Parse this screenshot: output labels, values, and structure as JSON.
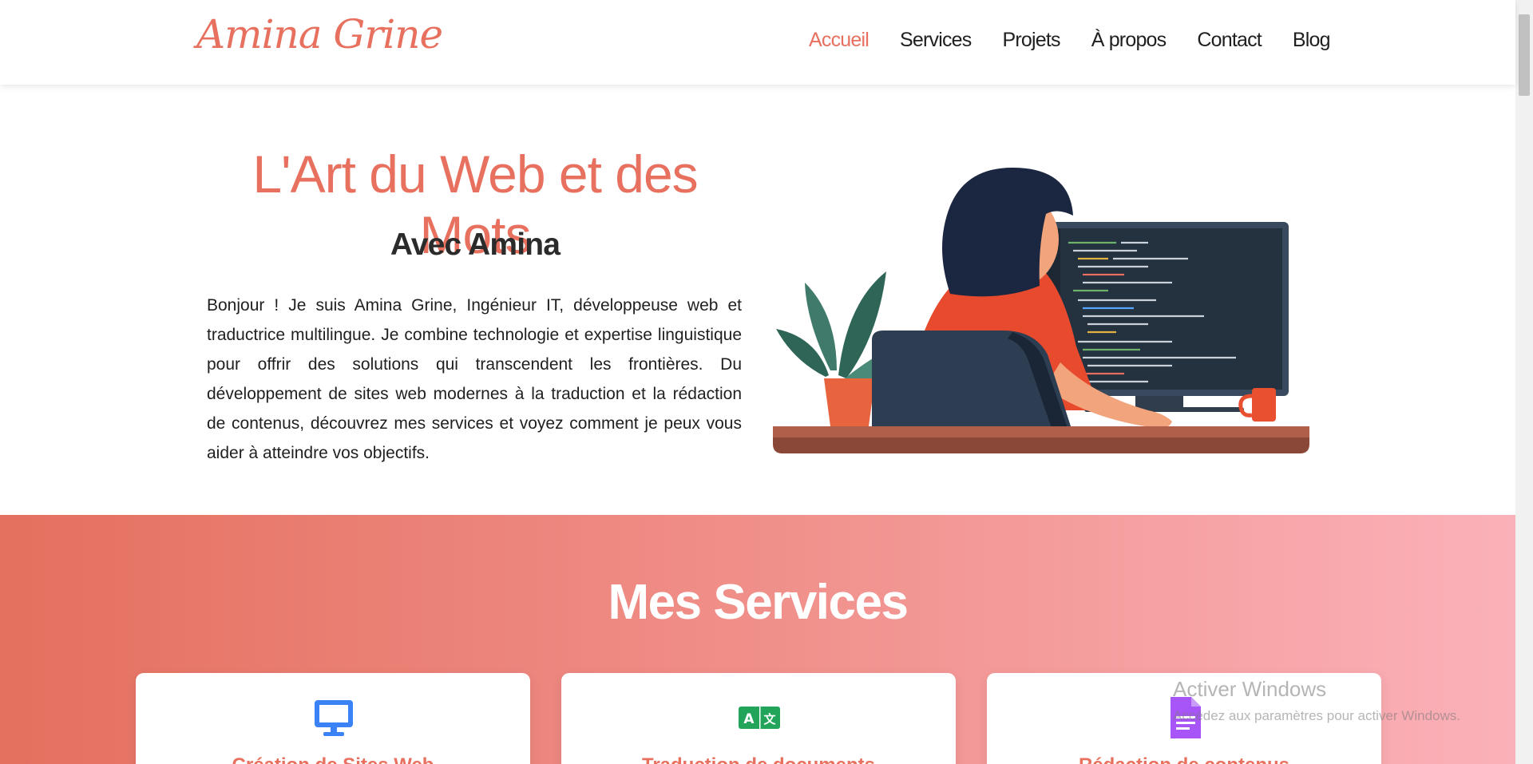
{
  "header": {
    "logo": "Amina Grine",
    "nav": [
      "Accueil",
      "Services",
      "Projets",
      "À propos",
      "Contact",
      "Blog"
    ],
    "active_item": "Accueil"
  },
  "hero": {
    "title": "L'Art du Web et des Mots",
    "subtitle": "Avec Amina",
    "text": "Bonjour ! Je suis Amina Grine, Ingénieur IT, développeuse web et traductrice multilingue. Je combine technologie et expertise linguistique pour offrir des solutions qui transcendent les frontières. Du développement de sites web modernes à la traduction et la rédaction de contenus, découvrez mes services et voyez comment je peux vous aider à atteindre vos objectifs."
  },
  "services": {
    "title": "Mes Services",
    "cards": [
      {
        "title": "Création de Sites Web",
        "icon": "monitor-icon",
        "icon_color": "#3b82f6"
      },
      {
        "title": "Traduction de documents",
        "icon": "translate-icon",
        "icon_color": "#22a55a"
      },
      {
        "title": "Rédaction de contenus",
        "icon": "document-icon",
        "icon_color": "#a855f7"
      }
    ]
  },
  "watermark": {
    "line1": "Activer Windows",
    "line2": "Accédez aux paramètres pour activer Windows."
  },
  "colors": {
    "accent": "#e8705f",
    "gradient_start": "#e4705f",
    "gradient_end": "#fbb1b9"
  }
}
